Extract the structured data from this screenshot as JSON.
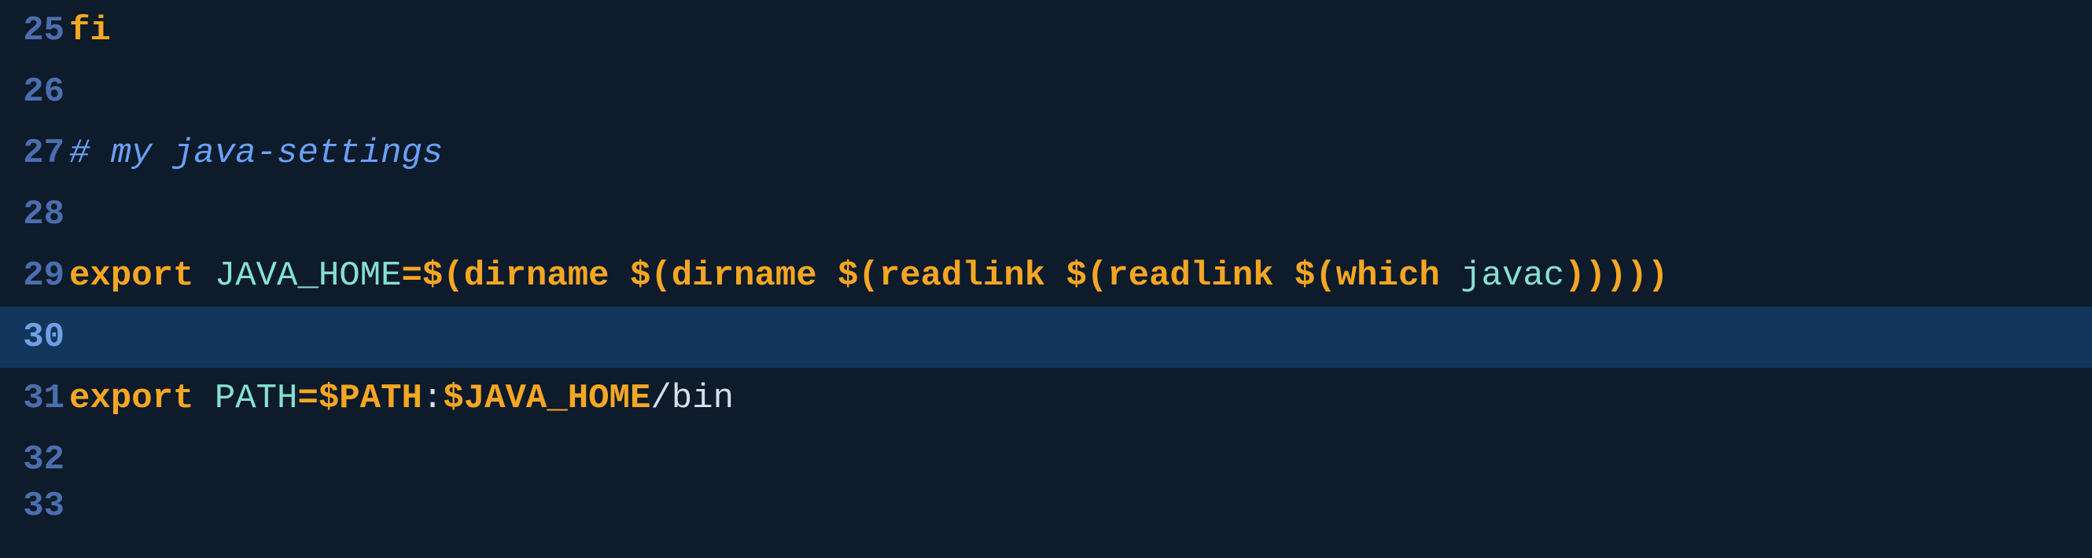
{
  "editor": {
    "gutter": {
      "l25": "25",
      "l26": "26",
      "l27": "27",
      "l28": "28",
      "l29": "29",
      "l30": "30",
      "l31": "31",
      "l32": "32",
      "l33": "33"
    },
    "lines": {
      "l25": {
        "fi": "fi"
      },
      "l27": {
        "comment": "# my java-settings"
      },
      "l29": {
        "export": "export",
        "sp1": " ",
        "var": "JAVA_HOME",
        "eq": "=",
        "d1": "$(",
        "dirname1": "dirname",
        "sp2": " ",
        "d2": "$(",
        "dirname2": "dirname",
        "sp3": " ",
        "d3": "$(",
        "readlink1": "readlink",
        "sp4": " ",
        "d4": "$(",
        "readlink2": "readlink",
        "sp5": " ",
        "d5": "$(",
        "which": "which",
        "sp6": " ",
        "javac": "javac",
        "close": ")))))"
      },
      "l31": {
        "export": "export",
        "sp1": " ",
        "var": "PATH",
        "eq": "=",
        "pathenv": "$PATH",
        "colon": ":",
        "javahome": "$JAVA_HOME",
        "bin": "/bin"
      }
    },
    "current_line": 30
  }
}
